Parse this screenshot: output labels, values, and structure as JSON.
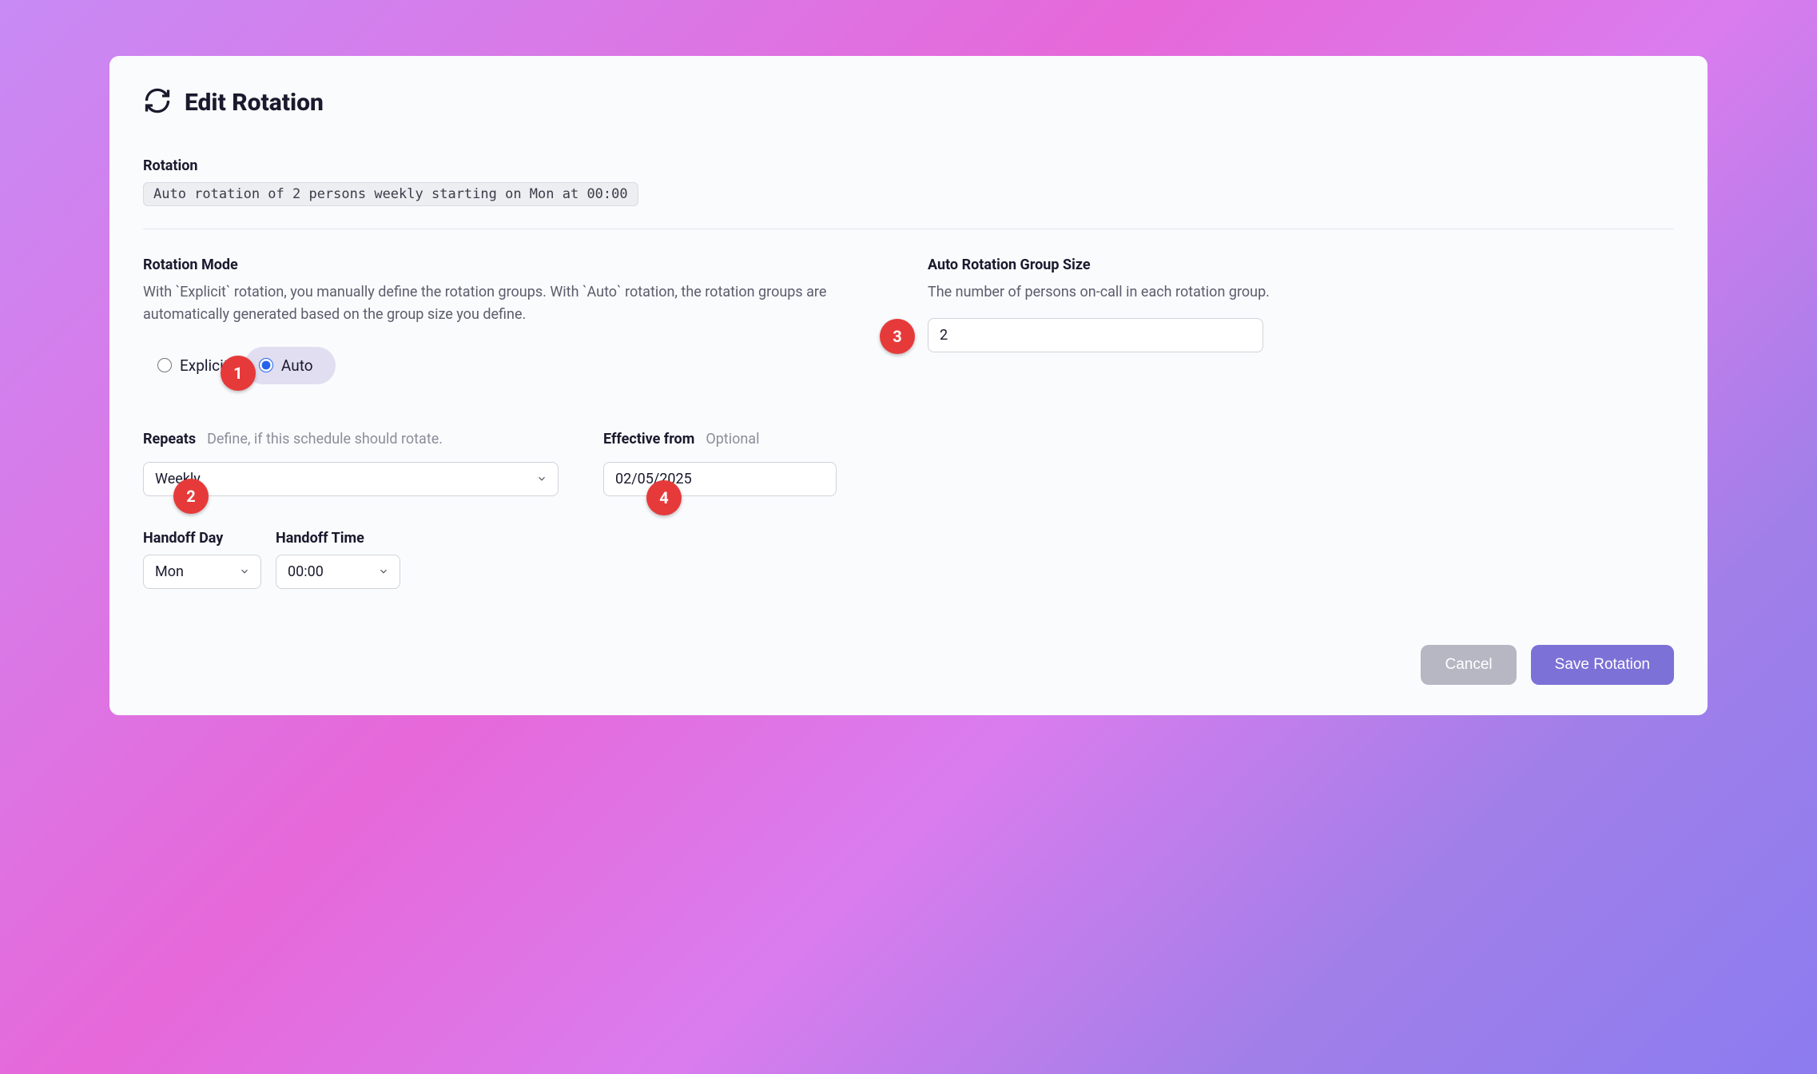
{
  "title": "Edit Rotation",
  "rotation": {
    "label": "Rotation",
    "summary": "Auto rotation of 2 persons weekly starting on Mon at 00:00"
  },
  "mode": {
    "label": "Rotation Mode",
    "help": "With `Explicit` rotation, you manually define the rotation groups. With `Auto` rotation, the rotation groups are automatically generated based on the group size you define.",
    "options": {
      "explicit": "Explicit",
      "auto": "Auto"
    },
    "selected": "auto"
  },
  "groupSize": {
    "label": "Auto Rotation Group Size",
    "help": "The number of persons on-call in each rotation group.",
    "value": "2"
  },
  "repeats": {
    "label": "Repeats",
    "hint": "Define, if this schedule should rotate.",
    "value": "Weekly"
  },
  "effective": {
    "label": "Effective from",
    "hint": "Optional",
    "value": "02/05/2025"
  },
  "handoffDay": {
    "label": "Handoff Day",
    "value": "Mon"
  },
  "handoffTime": {
    "label": "Handoff Time",
    "value": "00:00"
  },
  "actions": {
    "cancel": "Cancel",
    "save": "Save Rotation"
  },
  "markers": {
    "m1": "1",
    "m2": "2",
    "m3": "3",
    "m4": "4"
  }
}
